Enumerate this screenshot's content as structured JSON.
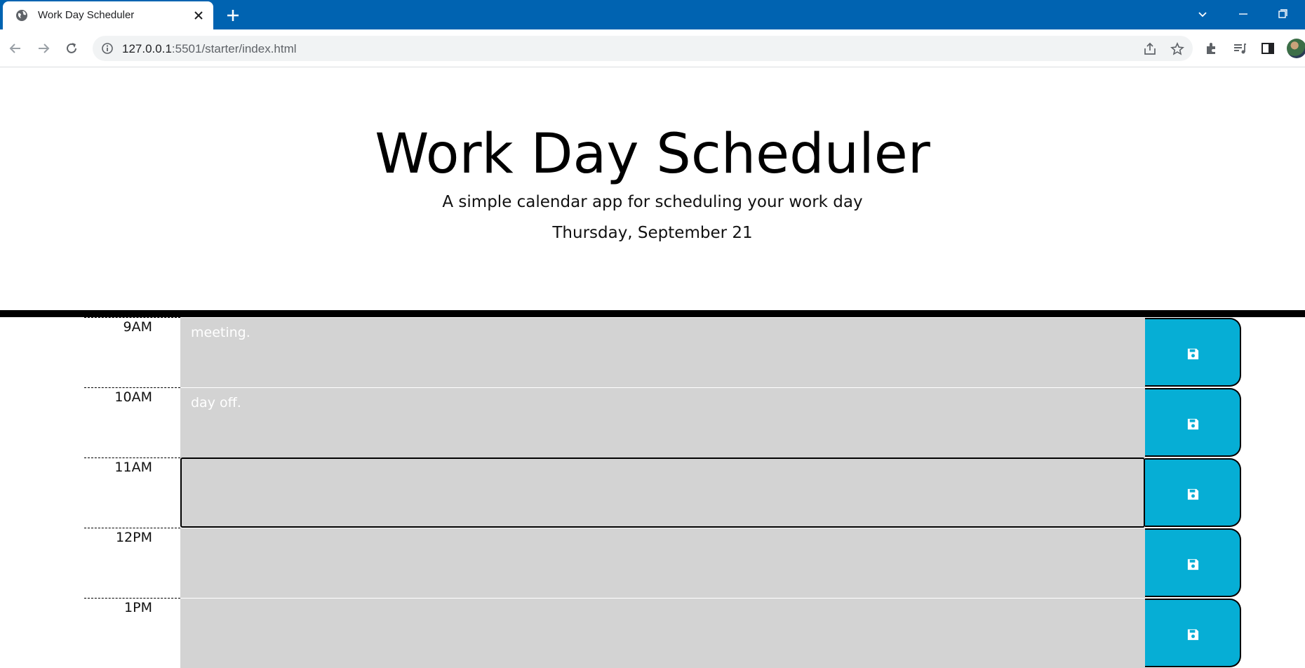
{
  "browser": {
    "tab_title": "Work Day Scheduler",
    "url_host": "127.0.0.1",
    "url_rest": ":5501/starter/index.html",
    "chrome_color": "#0063b1"
  },
  "header": {
    "title": "Work Day Scheduler",
    "lead": "A simple calendar app for scheduling your work day",
    "current_day": "Thursday, September 21"
  },
  "schedule": {
    "rows": [
      {
        "hour": "9AM",
        "text": "meeting.",
        "active": false
      },
      {
        "hour": "10AM",
        "text": "day off.",
        "active": false
      },
      {
        "hour": "11AM",
        "text": "",
        "active": true
      },
      {
        "hour": "12PM",
        "text": "",
        "active": false
      },
      {
        "hour": "1PM",
        "text": "",
        "active": false
      }
    ],
    "save_icon": "floppy-disk-icon",
    "colors": {
      "row_bg": "#d3d3d3",
      "save_bg": "#06aed5"
    }
  }
}
